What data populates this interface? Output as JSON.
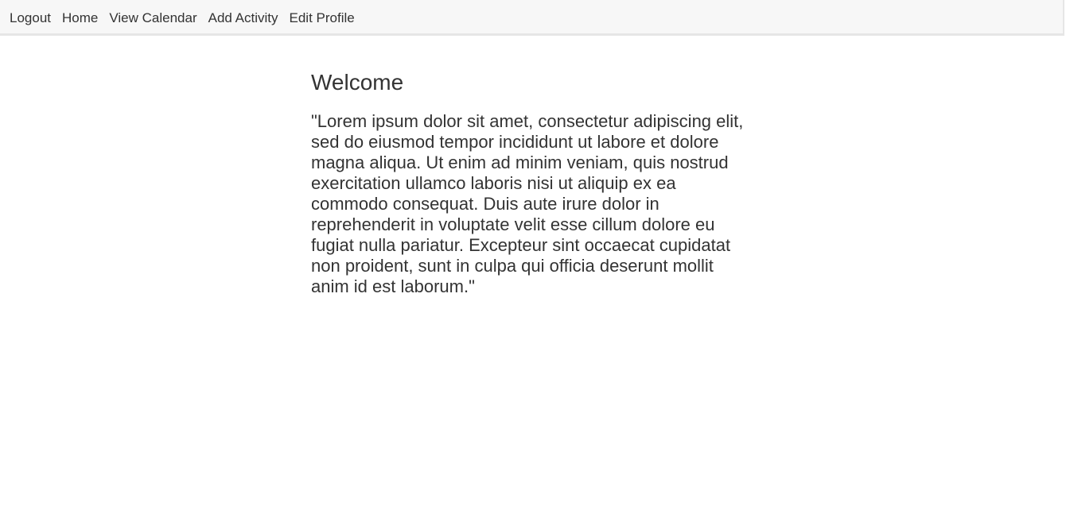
{
  "nav": {
    "items": [
      {
        "label": "Logout"
      },
      {
        "label": "Home"
      },
      {
        "label": "View Calendar"
      },
      {
        "label": "Add Activity"
      },
      {
        "label": "Edit Profile"
      }
    ]
  },
  "main": {
    "title": "Welcome",
    "body": "\"Lorem ipsum dolor sit amet, consectetur adipiscing elit, sed do eiusmod tempor incididunt ut labore et dolore magna aliqua. Ut enim ad minim veniam, quis nostrud exercitation ullamco laboris nisi ut aliquip ex ea commodo consequat. Duis aute irure dolor in reprehenderit in voluptate velit esse cillum dolore eu fugiat nulla pariatur. Excepteur sint occaecat cupidatat non proident, sunt in culpa qui officia deserunt mollit anim id est laborum.\""
  }
}
